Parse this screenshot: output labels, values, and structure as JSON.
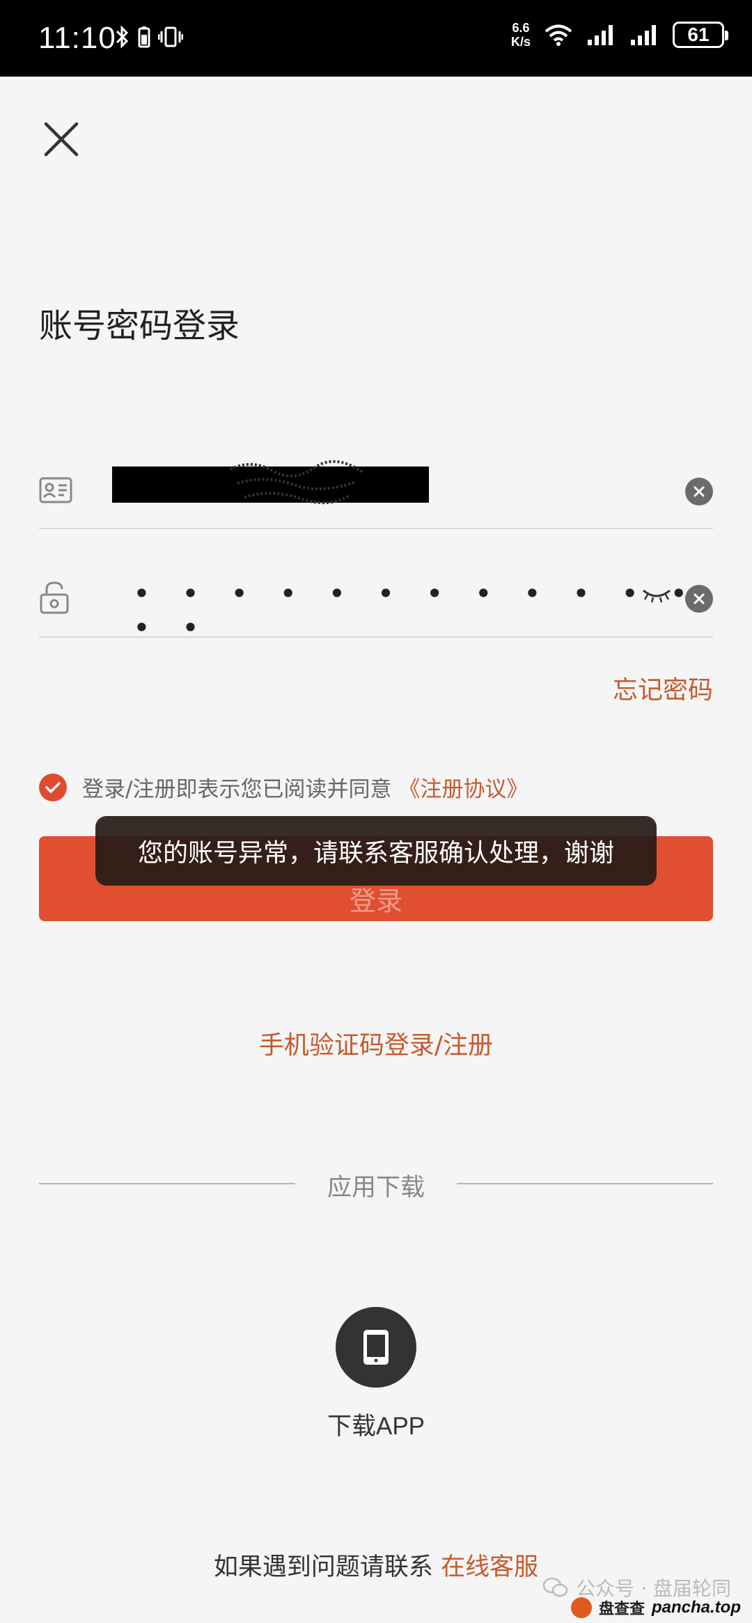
{
  "status_bar": {
    "time": "11:10",
    "net_speed_value": "6.6",
    "net_speed_unit": "K/s",
    "battery": "61"
  },
  "page": {
    "title": "账号密码登录"
  },
  "form": {
    "password_mask": "• • • • • • • • • • • • • •",
    "forgot_password": "忘记密码"
  },
  "agreement": {
    "text": "登录/注册即表示您已阅读并同意",
    "link": "《注册协议》"
  },
  "login_button": "登录",
  "toast": "您的账号异常，请联系客服确认处理，谢谢",
  "sms_login": "手机验证码登录/注册",
  "download": {
    "section_title": "应用下载",
    "label": "下载APP"
  },
  "contact": {
    "text": "如果遇到问题请联系",
    "link": "在线客服"
  },
  "watermark": {
    "account": "公众号 · 盘届轮同",
    "brand_cn": "盘查查",
    "brand_url": "pancha.top"
  },
  "colors": {
    "accent": "#e04f2f",
    "link": "#c65a2f"
  }
}
